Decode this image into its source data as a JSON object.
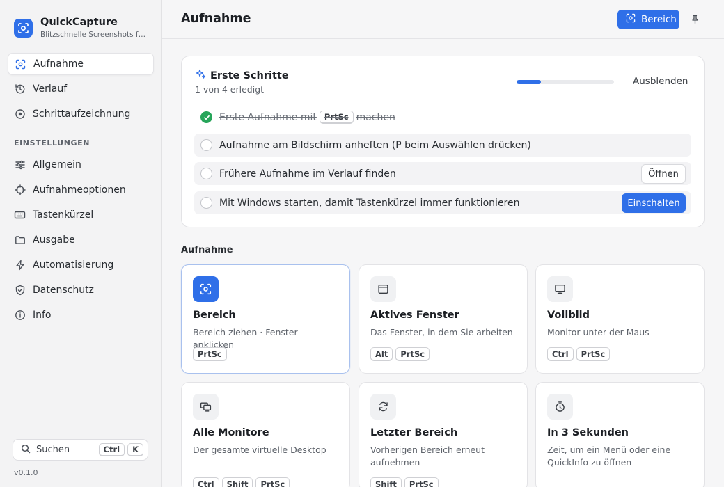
{
  "app": {
    "name": "QuickCapture",
    "tagline": "Blitzschnelle Screenshots für Windows",
    "version": "v0.1.0"
  },
  "sidebar": {
    "nav": [
      {
        "label": "Aufnahme",
        "icon": "capture-icon",
        "active": true
      },
      {
        "label": "Verlauf",
        "icon": "history-icon",
        "active": false
      },
      {
        "label": "Schrittaufzeichnung",
        "icon": "steps-icon",
        "active": false
      }
    ],
    "settings_label": "EINSTELLUNGEN",
    "settings": [
      {
        "label": "Allgemein",
        "icon": "sliders-icon"
      },
      {
        "label": "Aufnahmeoptionen",
        "icon": "crosshair-icon"
      },
      {
        "label": "Tastenkürzel",
        "icon": "keyboard-icon"
      },
      {
        "label": "Ausgabe",
        "icon": "folder-icon"
      },
      {
        "label": "Automatisierung",
        "icon": "bolt-icon"
      },
      {
        "label": "Datenschutz",
        "icon": "shield-icon"
      },
      {
        "label": "Info",
        "icon": "info-icon"
      }
    ],
    "search": {
      "label": "Suchen",
      "keys": [
        "Ctrl",
        "K"
      ]
    }
  },
  "header": {
    "title": "Aufnahme",
    "primary_button": "Bereich"
  },
  "onboarding": {
    "title": "Erste Schritte",
    "subtitle": "1 von 4 erledigt",
    "progress": 0.25,
    "hide_label": "Ausblenden",
    "steps": [
      {
        "before": "Erste Aufnahme mit",
        "key": "PrtSc",
        "after": "machen",
        "done": true
      },
      {
        "text": "Aufnahme am Bildschirm anheften (P beim Auswählen drücken)",
        "done": false
      },
      {
        "text": "Frühere Aufnahme im Verlauf finden",
        "done": false,
        "button": "Öffnen"
      },
      {
        "text": "Mit Windows starten, damit Tastenkürzel immer funktionieren",
        "done": false,
        "button": "Einschalten"
      }
    ]
  },
  "capture": {
    "section_label": "Aufnahme",
    "tiles": [
      {
        "title": "Bereich",
        "desc": "Bereich ziehen · Fenster anklicken",
        "keys": [
          "PrtSc"
        ],
        "icon": "region-icon",
        "selected": true
      },
      {
        "title": "Aktives Fenster",
        "desc": "Das Fenster, in dem Sie arbeiten",
        "keys": [
          "Alt",
          "PrtSc"
        ],
        "icon": "window-icon"
      },
      {
        "title": "Vollbild",
        "desc": "Monitor unter der Maus",
        "keys": [
          "Ctrl",
          "PrtSc"
        ],
        "icon": "monitor-icon"
      },
      {
        "title": "Alle Monitore",
        "desc": "Der gesamte virtuelle Desktop",
        "keys": [
          "Ctrl",
          "Shift",
          "PrtSc"
        ],
        "icon": "multi-monitor-icon"
      },
      {
        "title": "Letzter Bereich",
        "desc": "Vorherigen Bereich erneut aufnehmen",
        "keys": [
          "Shift",
          "PrtSc"
        ],
        "icon": "repeat-icon"
      },
      {
        "title": "In 3 Sekunden",
        "desc": "Zeit, um ein Menü oder eine QuickInfo zu öffnen",
        "keys": [],
        "icon": "timer-icon"
      }
    ]
  },
  "colors": {
    "accent": "#2f6fe8",
    "success": "#27a55a",
    "sidebar_bg": "#f3f3f4",
    "main_bg": "#f6f6f7"
  }
}
